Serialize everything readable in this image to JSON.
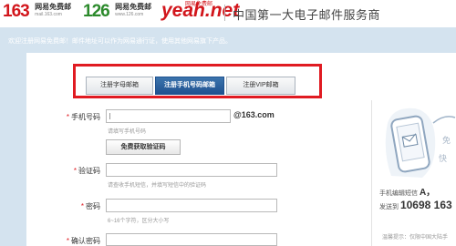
{
  "header": {
    "logos": [
      {
        "big": "163",
        "cn": "网易免费邮",
        "url": "mail.163.com"
      },
      {
        "big": "126",
        "cn": "网易免费邮",
        "url": "www.126.com"
      },
      {
        "big_main": "yeah",
        "big_dot": ".net",
        "cn": "网易免费邮"
      }
    ],
    "title": "中国第一大电子邮件服务商"
  },
  "notice": "欢迎注册网易免费邮！邮件地址可以作为网易通行证，使用其他网易旗下产品。",
  "tabs": [
    {
      "label": "注册字母邮箱",
      "active": false
    },
    {
      "label": "注册手机号码邮箱",
      "active": true
    },
    {
      "label": "注册VIP邮箱",
      "active": false
    }
  ],
  "form": {
    "mobile": {
      "required_mark": "*",
      "label": "手机号码",
      "placeholder": "",
      "suffix": "@163.com",
      "hint": "请填写手机号码"
    },
    "get_code_button": "免费获取验证码",
    "code": {
      "required_mark": "*",
      "label": "验证码",
      "hint": "请查收手机短信，并填写短信中的验证码"
    },
    "password": {
      "required_mark": "*",
      "label": "密码",
      "hint": "6~16个字符，区分大小写"
    },
    "confirm": {
      "required_mark": "*",
      "label": "确认密码"
    }
  },
  "side": {
    "sms_prefix": "手机编辑短信",
    "sms_letter": "A，",
    "send_prefix": "发送到",
    "send_number": "10698 163",
    "warm_tip": "温馨提示：仅限中国大陆手",
    "art_text": [
      "免",
      "快"
    ]
  },
  "colors": {
    "brand_red": "#d2161c",
    "frame_blue": "#d4e3ef",
    "active_tab": "#1f5290",
    "highlight_red": "#e01b22"
  }
}
